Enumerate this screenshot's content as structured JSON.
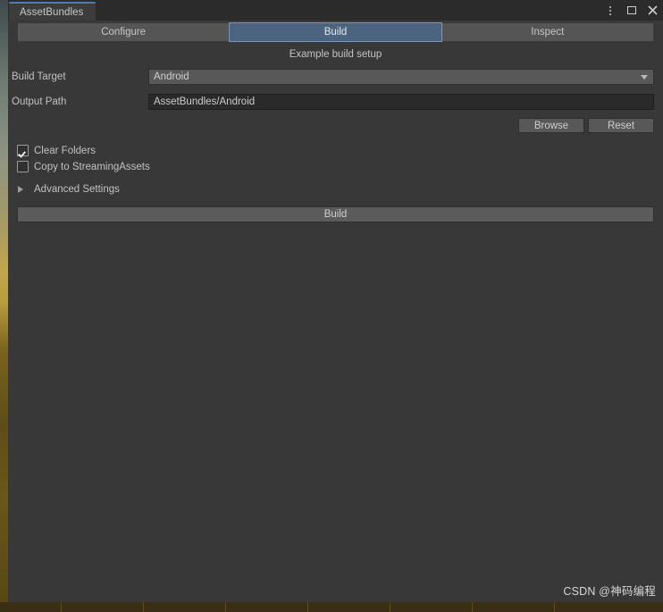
{
  "window": {
    "dock_tab_label": "AssetBundles",
    "controls": [
      {
        "name": "overflow-menu",
        "icon": "kebab-menu-icon"
      },
      {
        "name": "maximize",
        "icon": "maximize-icon"
      },
      {
        "name": "close",
        "icon": "close-icon"
      }
    ],
    "accent_color": "#4b7dad",
    "background_color": "#383838"
  },
  "mode_tabs": [
    {
      "label": "Configure",
      "active": false
    },
    {
      "label": "Build",
      "active": true
    },
    {
      "label": "Inspect",
      "active": false
    }
  ],
  "active_tab_color": "#4c6480",
  "build_panel": {
    "section_title": "Example build setup",
    "fields": [
      {
        "label": "Build Target",
        "type": "popup",
        "value": "Android"
      },
      {
        "label": "Output Path",
        "type": "text",
        "value": "AssetBundles/Android",
        "placeholder": ""
      }
    ],
    "path_buttons": [
      {
        "label": "Browse"
      },
      {
        "label": "Reset"
      }
    ],
    "toggles": [
      {
        "label": "Clear Folders",
        "checked": true
      },
      {
        "label": "Copy to StreamingAssets",
        "checked": false
      }
    ],
    "foldout": {
      "label": "Advanced Settings",
      "expanded": false,
      "arrow_icon": "triangle-right-icon"
    },
    "build_button_label": "Build"
  },
  "watermark": {
    "text": "CSDN @神码编程"
  }
}
